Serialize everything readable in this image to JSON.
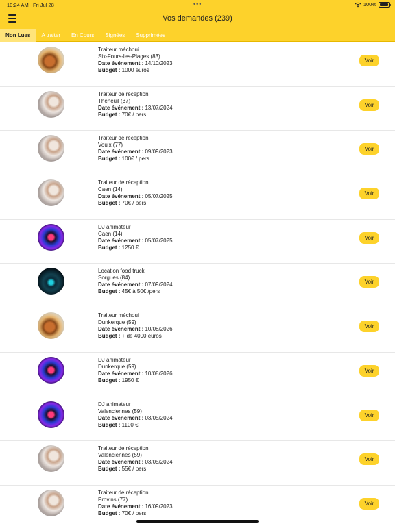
{
  "status_bar": {
    "time": "10:24 AM",
    "date": "Fri Jul 28",
    "dots": "•••",
    "battery": "100%",
    "battery_level": 1.0
  },
  "header": {
    "title": "Vos demandes (239)",
    "menu_icon": "hamburger-menu-icon"
  },
  "tabs": [
    {
      "label": "Non Lues",
      "active": true
    },
    {
      "label": "A traiter",
      "active": false
    },
    {
      "label": "En Cours",
      "active": false
    },
    {
      "label": "Signées",
      "active": false
    },
    {
      "label": "Supprimées",
      "active": false
    }
  ],
  "labels": {
    "date": "Date événement :",
    "budget": "Budget :",
    "voir": "Voir"
  },
  "requests": [
    {
      "avatar": "traiteur-mechoui",
      "service": "Traiteur méchoui",
      "location": "Six-Fours-les-Plages (83)",
      "date": "14/10/2023",
      "budget": "1000 euros"
    },
    {
      "avatar": "traiteur-reception",
      "service": "Traiteur de réception",
      "location": "Theneuil (37)",
      "date": "13/07/2024",
      "budget": "70€ / pers"
    },
    {
      "avatar": "traiteur-reception",
      "service": "Traiteur de réception",
      "location": "Voulx (77)",
      "date": "09/09/2023",
      "budget": "100€ / pers"
    },
    {
      "avatar": "traiteur-reception",
      "service": "Traiteur de réception",
      "location": "Caen (14)",
      "date": "05/07/2025",
      "budget": "70€ / pers"
    },
    {
      "avatar": "dj",
      "service": "DJ animateur",
      "location": "Caen (14)",
      "date": "05/07/2025",
      "budget": "1250 €"
    },
    {
      "avatar": "foodtruck",
      "service": "Location food truck",
      "location": "Sorgues (84)",
      "date": "07/09/2024",
      "budget": "45€ à 50€ /pers"
    },
    {
      "avatar": "traiteur-mechoui",
      "service": "Traiteur méchoui",
      "location": "Dunkerque (59)",
      "date": "10/08/2026",
      "budget": "+ de 4000 euros"
    },
    {
      "avatar": "dj",
      "service": "DJ animateur",
      "location": "Dunkerque (59)",
      "date": "10/08/2026",
      "budget": "1950 €"
    },
    {
      "avatar": "dj",
      "service": "DJ animateur",
      "location": "Valenciennes (59)",
      "date": "03/05/2024",
      "budget": "1100 €"
    },
    {
      "avatar": "traiteur-reception",
      "service": "Traiteur de réception",
      "location": "Valenciennes (59)",
      "date": "03/05/2024",
      "budget": "55€ / pers"
    },
    {
      "avatar": "traiteur-reception",
      "service": "Traiteur de réception",
      "location": "Provins (77)",
      "date": "16/09/2023",
      "budget": "70€ / pers"
    }
  ]
}
